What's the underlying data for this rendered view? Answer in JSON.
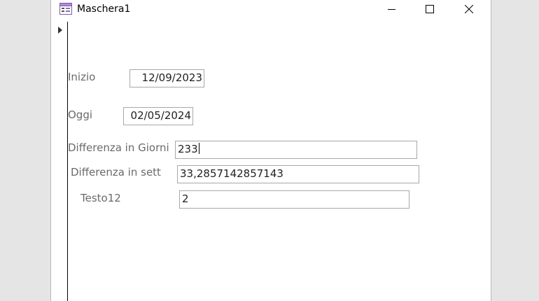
{
  "window": {
    "title": "Maschera1",
    "icon": "form-icon"
  },
  "controls": {
    "minimize": "minimize-icon",
    "maximize": "maximize-icon",
    "close": "close-icon"
  },
  "form": {
    "inizio": {
      "label": "Inizio",
      "value": "12/09/2023"
    },
    "oggi": {
      "label": "Oggi",
      "value": "02/05/2024"
    },
    "diff_giorni": {
      "label": "Differenza in Giorni",
      "value": "233"
    },
    "diff_sett": {
      "label": "Differenza in sett",
      "value": "33,2857142857143"
    },
    "testo12": {
      "label": "Testo12",
      "value": "2"
    }
  }
}
